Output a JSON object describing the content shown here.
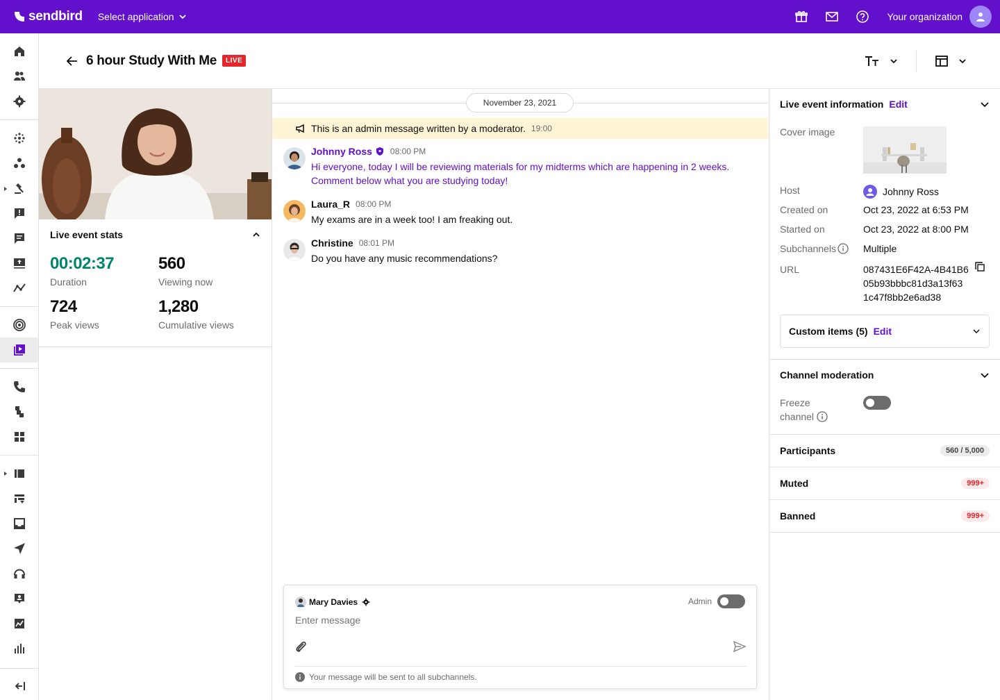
{
  "topbar": {
    "brand": "sendbird",
    "app_select": "Select application",
    "org": "Your organization",
    "icons": [
      "gift-icon",
      "mail-icon",
      "help-icon",
      "user-icon"
    ],
    "color": "#6210cc"
  },
  "header": {
    "title": "6 hour Study With Me",
    "live_badge": "LIVE"
  },
  "stats": {
    "title": "Live event stats",
    "duration": "00:02:37",
    "duration_label": "Duration",
    "viewing": "560",
    "viewing_label": "Viewing now",
    "peak": "724",
    "peak_label": "Peak views",
    "cumulative": "1,280",
    "cumulative_label": "Cumulative views"
  },
  "chat": {
    "date": "November 23, 2021",
    "admin_message": "This is an admin message written by a moderator.",
    "admin_time": "19:00",
    "messages": [
      {
        "name": "Johnny Ross",
        "time": "08:00 PM",
        "line1": "Hi everyone, today I will be reviewing materials for my midterms which are happening in 2 weeks.",
        "line2": "Comment below what you are studying today!"
      },
      {
        "name": "Laura_R",
        "time": "08:00 PM",
        "line1": "My exams are in a week too! I am freaking out."
      },
      {
        "name": "Christine",
        "time": "08:01 PM",
        "line1": "Do you have any music recommendations?"
      }
    ]
  },
  "composer": {
    "user": "Mary Davies",
    "admin_label": "Admin",
    "placeholder": "Enter message",
    "note": "Your message will be sent to all subchannels."
  },
  "info": {
    "title": "Live event information",
    "edit": "Edit",
    "cover_label": "Cover image",
    "host_label": "Host",
    "host": "Johnny Ross",
    "created_label": "Created on",
    "created": "Oct 23, 2022 at 6:53 PM",
    "started_label": "Started on",
    "started": "Oct 23, 2022 at 8:00 PM",
    "subchannels_label": "Subchannels",
    "subchannels": "Multiple",
    "url_label": "URL",
    "url_1": "087431E6F42A-4B41B6",
    "url_2": "05b93bbbc81d3a13f63",
    "url_3": "1c47f8bb2e6ad38",
    "custom_items": "Custom items (5)",
    "custom_edit": "Edit"
  },
  "moderation": {
    "title": "Channel moderation",
    "freeze_1": "Freeze",
    "freeze_2": "channel"
  },
  "lists": {
    "participants": "Participants",
    "participants_count": "560 / 5,000",
    "muted": "Muted",
    "muted_count": "999+",
    "banned": "Banned",
    "banned_count": "999+"
  }
}
